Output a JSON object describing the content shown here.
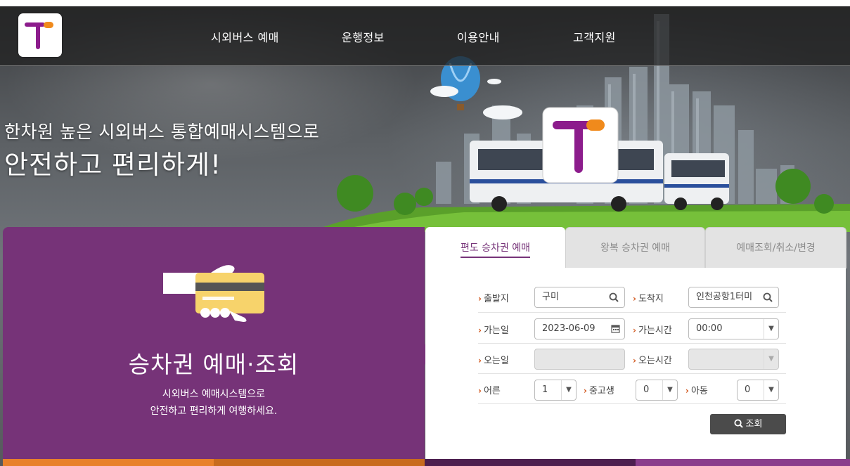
{
  "nav": {
    "items": [
      {
        "label": "시외버스 예매"
      },
      {
        "label": "운행정보"
      },
      {
        "label": "이용안내"
      },
      {
        "label": "고객지원"
      }
    ]
  },
  "hero": {
    "tagline_line1": "한차원 높은 시외버스 통합예매시스템으로",
    "tagline_line2": "안전하고 편리하게!"
  },
  "panel": {
    "title": "승차권 예매·조회",
    "subtitle_line1": "시외버스 예매시스템으로",
    "subtitle_line2": "안전하고 편리하게 여행하세요."
  },
  "tabs": [
    {
      "label": "편도 승차권 예매",
      "active": true
    },
    {
      "label": "왕복 승차권 예매",
      "active": false
    },
    {
      "label": "예매조회/취소/변경",
      "active": false
    }
  ],
  "form": {
    "departure_label": "출발지",
    "departure_value": "구미",
    "arrival_label": "도착지",
    "arrival_value": "인천공항1터미",
    "go_date_label": "가는일",
    "go_date_value": "2023-06-09",
    "go_time_label": "가는시간",
    "go_time_value": "00:00",
    "return_date_label": "오는일",
    "return_time_label": "오는시간",
    "adult_label": "어른",
    "adult_value": "1",
    "youth_label": "중고생",
    "youth_value": "0",
    "child_label": "아동",
    "child_value": "0",
    "search_button": "조회"
  },
  "colors": {
    "brand_purple": "#763378",
    "brand_orange": "#f08a1c",
    "arrow_accent": "#d2561b",
    "button_dark": "#4b4b4b"
  }
}
